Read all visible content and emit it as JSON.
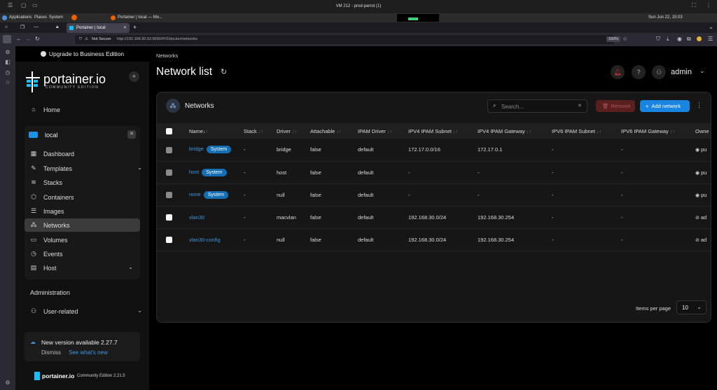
{
  "vm": {
    "title": "VM 212 - prod-parrot (1)"
  },
  "desktop": {
    "menu": [
      "Applications",
      "Places",
      "System"
    ],
    "window_title": "Portainer | local — Mo...",
    "clock": "Sun Jun 22, 15:03"
  },
  "browser": {
    "tab_title": "Portainer | local",
    "security_label": "Not Secure",
    "url": "http://192.168.30.52:9000/#!/2/docker/networks",
    "zoom": "160%"
  },
  "sidebar": {
    "upgrade_label": "Upgrade to Business Edition",
    "brand": "portainer.io",
    "brand_sub": "COMMUNITY EDITION",
    "home_label": "Home",
    "env_name": "local",
    "env_items": [
      {
        "label": "Dashboard",
        "icon": "dashboard-icon"
      },
      {
        "label": "Templates",
        "icon": "templates-icon"
      },
      {
        "label": "Stacks",
        "icon": "stacks-icon"
      },
      {
        "label": "Containers",
        "icon": "containers-icon"
      },
      {
        "label": "Images",
        "icon": "images-icon"
      },
      {
        "label": "Networks",
        "icon": "networks-icon"
      },
      {
        "label": "Volumes",
        "icon": "volumes-icon"
      },
      {
        "label": "Events",
        "icon": "events-icon"
      },
      {
        "label": "Host",
        "icon": "host-icon"
      }
    ],
    "admin_heading": "Administration",
    "user_related_label": "User-related",
    "update": {
      "text": "New version available 2.27.7",
      "dismiss": "Dismiss",
      "whats_new": "See what's new"
    },
    "footer_brand": "portainer.io",
    "footer_edition": "Community Edition 2.21.5"
  },
  "header": {
    "breadcrumb": "Networks",
    "title": "Network list",
    "username": "admin"
  },
  "table": {
    "title": "Networks",
    "search_placeholder": "Search...",
    "remove_label": "Remove",
    "add_label": "Add network",
    "columns": [
      "Name",
      "Stack",
      "Driver",
      "Attachable",
      "IPAM Driver",
      "IPV4 IPAM Subnet",
      "IPV4 IPAM Gateway",
      "IPV6 IPAM Subnet",
      "IPV6 IPAM Gateway",
      "Owne"
    ],
    "rows": [
      {
        "name": "bridge",
        "badge": "System",
        "stack": "-",
        "driver": "bridge",
        "attachable": "false",
        "ipam": "default",
        "v4sub": "172.17.0.0/16",
        "v4gw": "172.17.0.1",
        "v6sub": "-",
        "v6gw": "-",
        "owner": "pu"
      },
      {
        "name": "host",
        "badge": "System",
        "stack": "-",
        "driver": "host",
        "attachable": "false",
        "ipam": "default",
        "v4sub": "-",
        "v4gw": "-",
        "v6sub": "-",
        "v6gw": "-",
        "owner": "pu"
      },
      {
        "name": "none",
        "badge": "System",
        "stack": "-",
        "driver": "null",
        "attachable": "false",
        "ipam": "default",
        "v4sub": "-",
        "v4gw": "-",
        "v6sub": "-",
        "v6gw": "-",
        "owner": "pu"
      },
      {
        "name": "vlan30",
        "badge": "",
        "stack": "-",
        "driver": "macvlan",
        "attachable": "false",
        "ipam": "default",
        "v4sub": "192.168.30.0/24",
        "v4gw": "192.168.30.254",
        "v6sub": "-",
        "v6gw": "-",
        "owner": "ad"
      },
      {
        "name": "vlan30-config",
        "badge": "",
        "stack": "-",
        "driver": "null",
        "attachable": "false",
        "ipam": "default",
        "v4sub": "192.168.30.0/24",
        "v4gw": "192.168.30.254",
        "v6sub": "-",
        "v6gw": "-",
        "owner": "ad"
      }
    ],
    "items_per_page_label": "Items per page",
    "items_per_page": "10"
  },
  "colors": {
    "accent": "#1a85e0",
    "link": "#3b97e3",
    "badge": "#146eb4",
    "remove": "#5a1f1f"
  }
}
